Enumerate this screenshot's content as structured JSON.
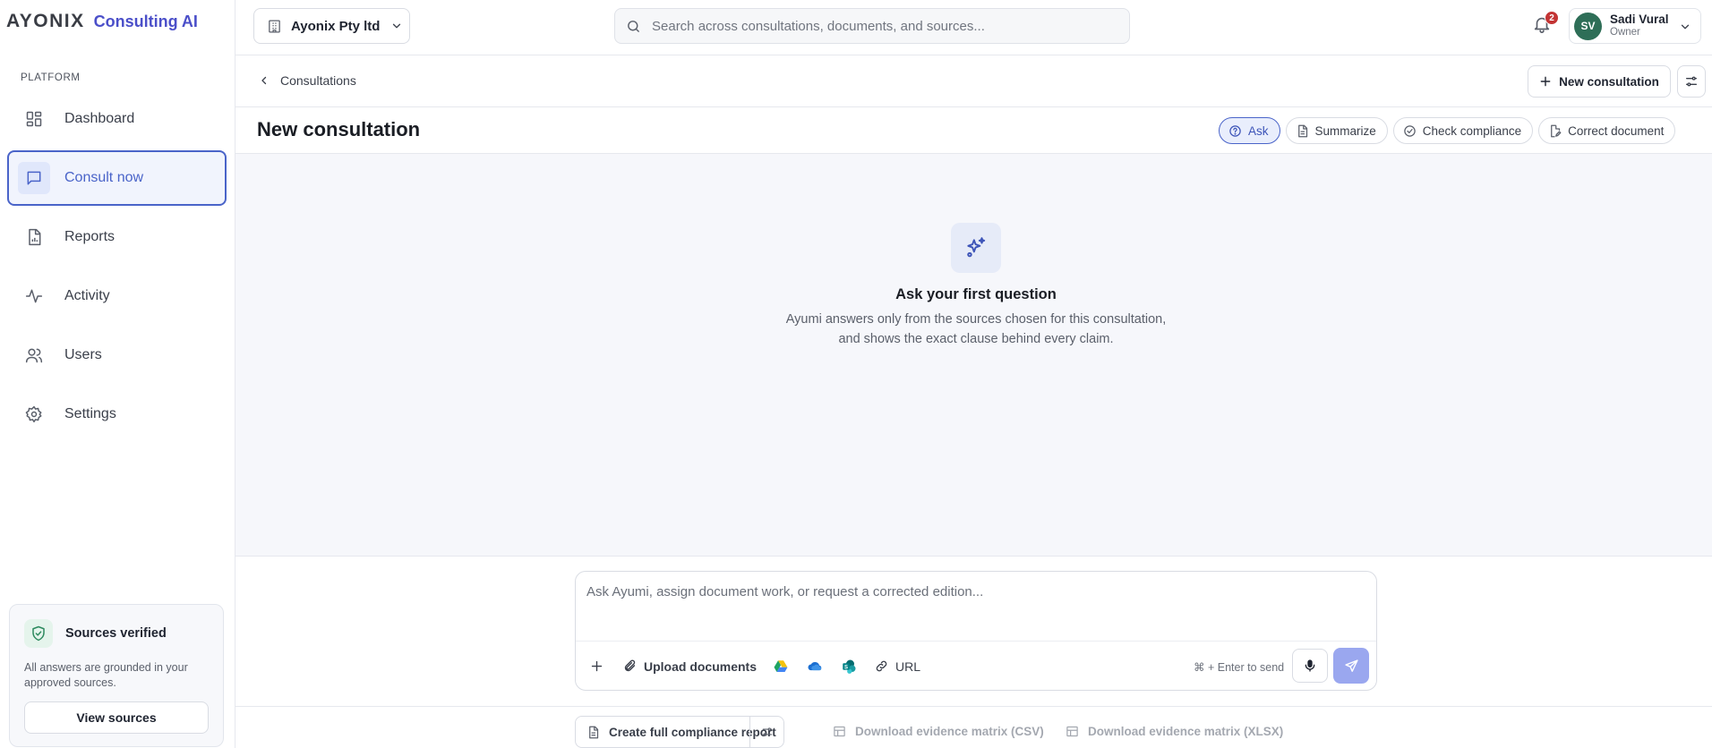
{
  "brand": {
    "name": "AYONIX",
    "product": "Consulting AI"
  },
  "sidebar": {
    "section_label": "PLATFORM",
    "items": [
      {
        "label": "Dashboard",
        "icon": "dashboard-icon"
      },
      {
        "label": "Consult now",
        "icon": "chat-icon",
        "active": true
      },
      {
        "label": "Reports",
        "icon": "report-icon"
      },
      {
        "label": "Activity",
        "icon": "activity-icon"
      },
      {
        "label": "Users",
        "icon": "users-icon"
      },
      {
        "label": "Settings",
        "icon": "gear-icon"
      }
    ],
    "sources_card": {
      "title": "Sources verified",
      "description": "All answers are grounded in your approved sources.",
      "button_label": "View sources",
      "icon": "shield-check-icon"
    }
  },
  "topbar": {
    "org_name": "Ayonix Pty ltd",
    "search_placeholder": "Search across consultations, documents, and sources...",
    "notification_count": "2",
    "user": {
      "initials": "SV",
      "name": "Sadi Vural",
      "role": "Owner"
    }
  },
  "breadcrumb": {
    "label": "Consultations"
  },
  "actions": {
    "new_consultation": "New consultation"
  },
  "page": {
    "title": "New consultation"
  },
  "modes": [
    {
      "label": "Ask",
      "active": true,
      "icon": "question-circle-icon"
    },
    {
      "label": "Summarize",
      "icon": "document-icon"
    },
    {
      "label": "Check compliance",
      "icon": "check-circle-icon"
    },
    {
      "label": "Correct document",
      "icon": "document-edit-icon"
    }
  ],
  "empty_state": {
    "icon": "sparkle-icon",
    "title": "Ask your first question",
    "line1": "Ayumi answers only from the sources chosen for this consultation,",
    "line2": "and shows the exact clause behind every claim."
  },
  "composer": {
    "placeholder": "Ask Ayumi, assign document work, or request a corrected edition...",
    "upload_label": "Upload documents",
    "url_label": "URL",
    "send_hint": "⌘ + Enter to send",
    "services": [
      "google-drive-icon",
      "onedrive-icon",
      "sharepoint-icon"
    ]
  },
  "bottom": {
    "report_label": "Create full compliance report",
    "csv_label": "Download evidence matrix (CSV)",
    "xlsx_label": "Download evidence matrix (XLSX)"
  },
  "colors": {
    "accent": "#4a64c9",
    "brand": "#4b4fc9",
    "avatar": "#2e6e57",
    "badge": "#c33434",
    "send": "#9aa7ef"
  }
}
